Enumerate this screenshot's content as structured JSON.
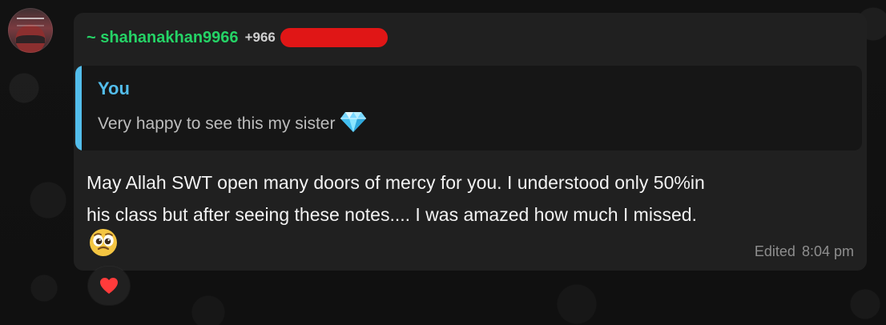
{
  "message": {
    "sender": {
      "name": "~ shahanakhan9966",
      "phone": "+966"
    },
    "quoted": {
      "author": "You",
      "text": "Very happy to see this my sister"
    },
    "body": {
      "line1": "May Allah SWT open many doors of mercy for you. I understood only 50%in",
      "line2": "his class but after seeing these notes.... I was amazed how much I missed."
    },
    "meta": {
      "edited_label": "Edited",
      "time": "8:04 pm"
    },
    "reaction": {
      "icon": "heart-icon"
    }
  },
  "colors": {
    "background": "#111111",
    "bubble": "#202020",
    "quote_bg": "#161616",
    "sender": "#25d366",
    "quote_accent": "#53bdeb",
    "body_text": "#f2f2f2",
    "meta_text": "#8e8e8e",
    "redaction": "#e01616",
    "heart": "#ff3b3b"
  },
  "icons": {
    "avatar": "profile-avatar",
    "quoted_emoji": "gem-icon",
    "body_emoji": "pleading-face-icon"
  }
}
